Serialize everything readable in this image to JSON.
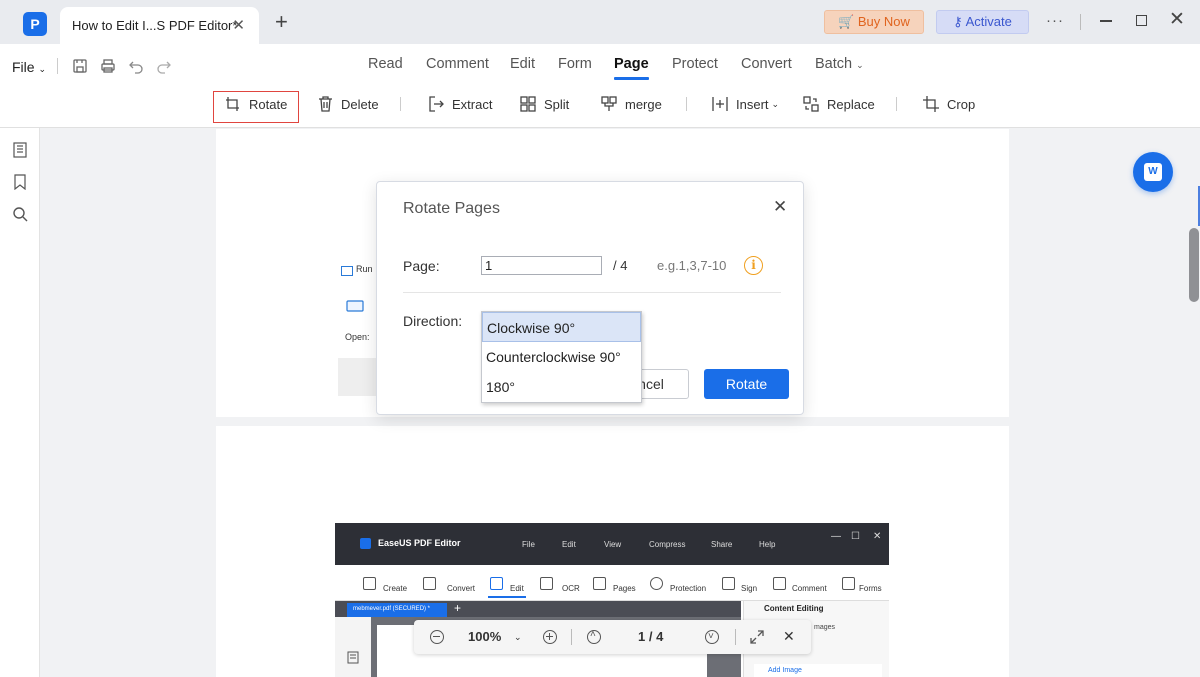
{
  "titlebar": {
    "logo_letter": "P",
    "tab_title": "How to Edit I...S PDF Editor*",
    "tab_close": "✕",
    "new_tab": "+",
    "buy_now": "Buy Now",
    "activate": "Activate",
    "more": "···",
    "close": "✕"
  },
  "menubar": {
    "file": "File",
    "items": [
      "Read",
      "Comment",
      "Edit",
      "Form",
      "Page",
      "Protect",
      "Convert",
      "Batch"
    ],
    "active": "Page"
  },
  "toolbar": {
    "rotate": "Rotate",
    "delete": "Delete",
    "extract": "Extract",
    "split": "Split",
    "merge": "merge",
    "insert": "Insert",
    "replace": "Replace",
    "crop": "Crop"
  },
  "document": {
    "thumb_run": "Run",
    "thumb_open": "Open:",
    "embedded": {
      "app_title": "EaseUS PDF Editor",
      "menu": [
        "File",
        "Edit",
        "View",
        "Compress",
        "Share",
        "Help"
      ],
      "window_controls": [
        "—",
        "☐",
        "✕"
      ],
      "tools": [
        "Create",
        "Convert",
        "Edit",
        "OCR",
        "Pages",
        "Protection",
        "Sign",
        "Comment",
        "Forms"
      ],
      "tab": "mebmever.pdf (SECURED) *",
      "tab_plus": "+",
      "content_editing": "Content Editing",
      "images": "mages",
      "add_image": "Add Image"
    }
  },
  "zoombar": {
    "zoom": "100%",
    "page_current": "1",
    "page_total": "4",
    "page_display": "1 / 4"
  },
  "word_button": "W",
  "dialog": {
    "title": "Rotate Pages",
    "close": "✕",
    "page_label": "Page:",
    "page_value": "1",
    "page_total": "/ 4",
    "page_hint": "e.g.1,3,7-10",
    "info": "i",
    "direction_label": "Direction:",
    "cancel": "ncel",
    "rotate": "Rotate"
  },
  "dropdown": {
    "options": [
      "Clockwise 90°",
      "Counterclockwise 90°",
      "180°"
    ],
    "selected": "Clockwise 90°"
  },
  "colors": {
    "accent": "#1a6ee8",
    "buy_now": "#e0641f",
    "activate": "#3b57cf",
    "highlight_border": "#e0453f",
    "info": "#f0a020"
  }
}
